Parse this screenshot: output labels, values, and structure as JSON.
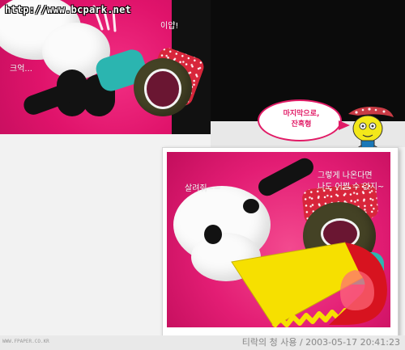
{
  "watermark": {
    "url": "http://www.bcpark.net"
  },
  "top_photo": {
    "caption_left": "크억...",
    "caption_right": "이얍!"
  },
  "speech_bubble": {
    "text": "마지막으로,\n잔혹형"
  },
  "bottom_photo": {
    "caption_left": "살려줘~~",
    "caption_right_line1": "그렇게 나온다면",
    "caption_right_line2": "나도 어쩔 수 없지~"
  },
  "footer": {
    "left": "WWW.FPAPER.CO.KR",
    "right": "티락의 청 사용 / 2003-05-17 20:41:23"
  },
  "colors": {
    "pink_background": "#e0136b",
    "bubble_border": "#e11b66",
    "black": "#0b0b0b",
    "gray": "#e9e9e9"
  }
}
